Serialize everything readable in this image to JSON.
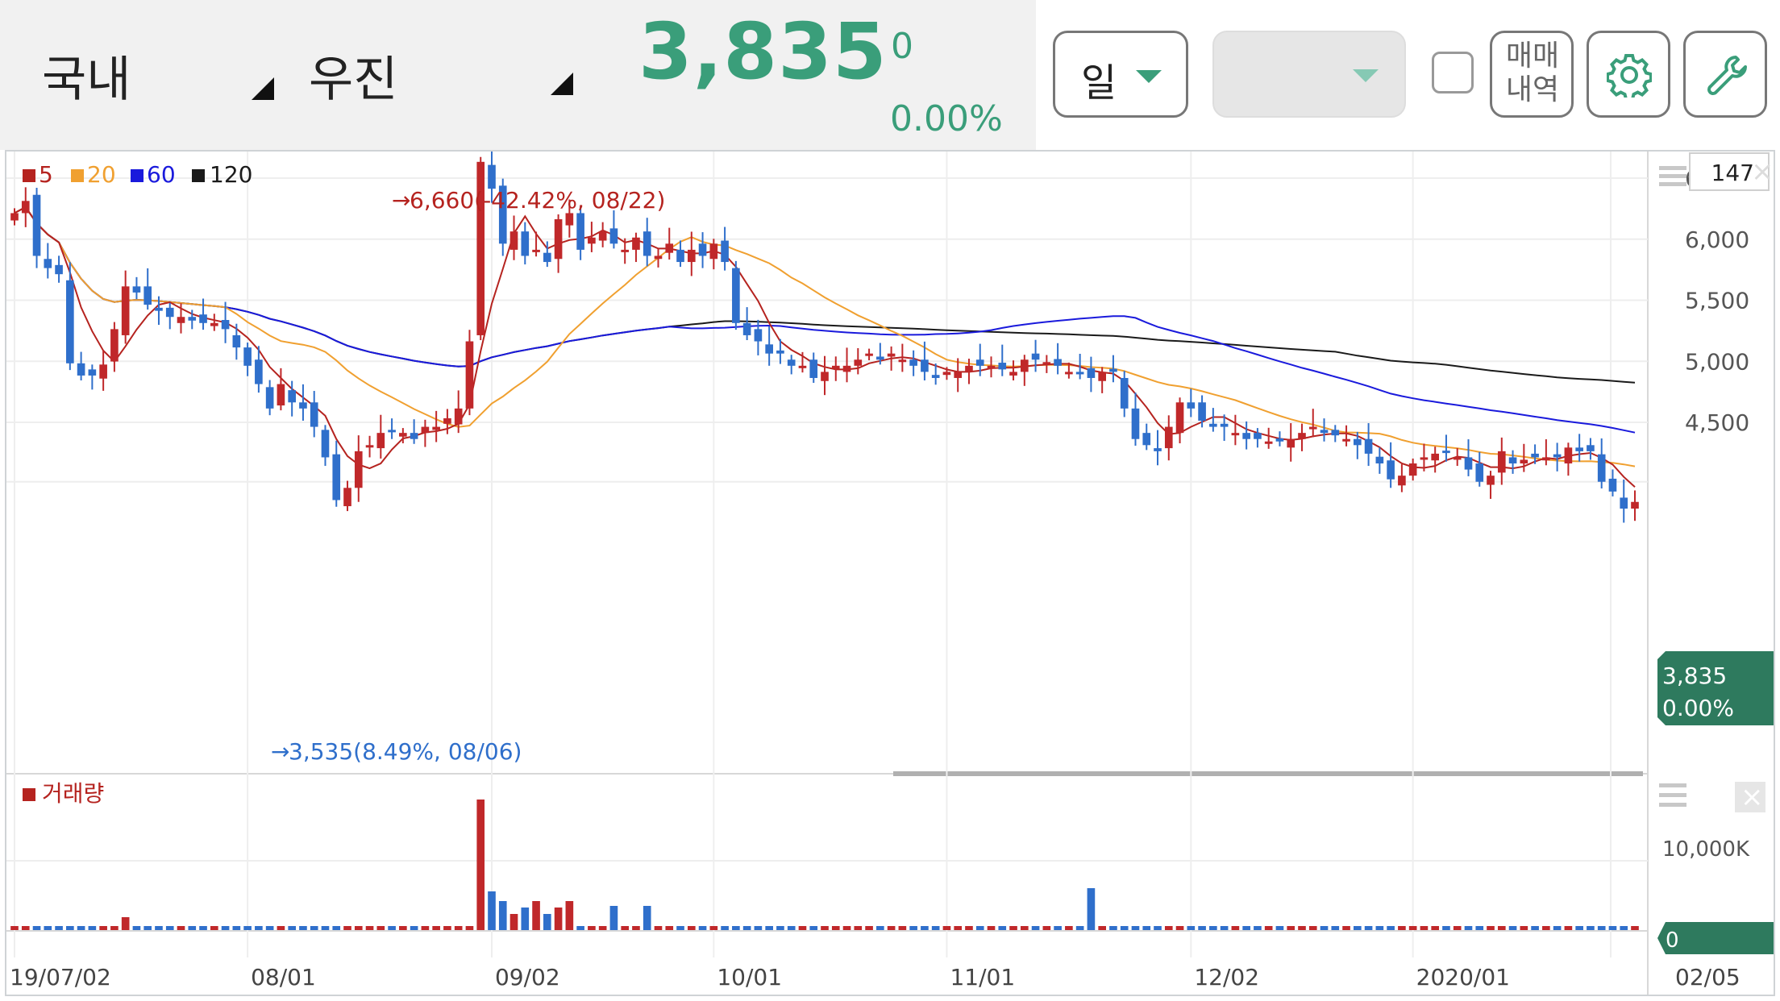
{
  "header": {
    "market_label": "국내",
    "stock_name": "우진",
    "price": "3,835",
    "change": "0",
    "change_pct": "0.00%",
    "accent_color": "#3a9e7a"
  },
  "toolbar": {
    "period_label": "일",
    "secondary_select": "",
    "trade_history_line1": "매매",
    "trade_history_line2": "내역",
    "settings_icon": "gear-icon",
    "tools_icon": "wrench-icon"
  },
  "chart_data": {
    "type": "candlestick",
    "legend": [
      {
        "name": "5",
        "color": "#b5231f"
      },
      {
        "name": "20",
        "color": "#f0a030"
      },
      {
        "name": "60",
        "color": "#1a1adc"
      },
      {
        "name": "120",
        "color": "#1a1a1a"
      }
    ],
    "visible_count": "147",
    "y_ticks": [
      "6,500",
      "6,000",
      "5,500",
      "5,000",
      "4,500"
    ],
    "y_tick_values": [
      6500,
      6000,
      5500,
      5000,
      4500
    ],
    "x_ticks": [
      "19/07/02",
      "08/01",
      "09/02",
      "10/01",
      "11/01",
      "12/02",
      "2020/01",
      "02/05"
    ],
    "high_annotation": "6,660(-42.42%, 08/22)",
    "low_annotation": "3,535(8.49%, 08/06)",
    "current_price_label": "3,835",
    "current_pct_label": "0.00%",
    "up_color": "#c0282a",
    "down_color": "#2f6fcb",
    "closes": [
      6200,
      6300,
      5850,
      5750,
      5700,
      4970,
      4870,
      4870,
      4960,
      5250,
      5600,
      5550,
      5450,
      5400,
      5350,
      5350,
      5320,
      5300,
      5300,
      5250,
      5100,
      4950,
      4800,
      4600,
      4800,
      4650,
      4600,
      4450,
      4200,
      3850,
      3950,
      4250,
      4300,
      4400,
      4420,
      4400,
      4350,
      4450,
      4450,
      4520,
      4600,
      5150,
      6620,
      6400,
      5950,
      6050,
      5850,
      5900,
      5800,
      6150,
      6200,
      5900,
      6000,
      6050,
      5950,
      5900,
      6000,
      5850,
      5850,
      5950,
      5800,
      5900,
      5850,
      5950,
      5800,
      5300,
      5200,
      5150,
      5050,
      5050,
      4950,
      4950,
      4850,
      4900,
      4950,
      4950,
      5000,
      5050,
      5000,
      5050,
      5000,
      4950,
      4900,
      4850,
      4900,
      4900,
      4950,
      4950,
      4950,
      4920,
      4900,
      5000,
      5000,
      4980,
      4950,
      4900,
      4880,
      4850,
      4900,
      4900,
      4600,
      4350,
      4300,
      4250,
      4450,
      4650,
      4600,
      4500,
      4450,
      4450,
      4400,
      4350,
      4350,
      4330,
      4330,
      4350,
      4400,
      4450,
      4400,
      4380,
      4350,
      4300,
      4230,
      4150,
      4020,
      4050,
      4150,
      4200,
      4230,
      4250,
      4200,
      4100,
      4000,
      4050,
      4250,
      4150,
      4180,
      4200,
      4200,
      4200,
      4280,
      4250,
      4250,
      4000,
      3920,
      3780,
      3835
    ]
  },
  "volume": {
    "legend_label": "거래량",
    "y_tick": "10,000K",
    "zero_label": "0"
  }
}
